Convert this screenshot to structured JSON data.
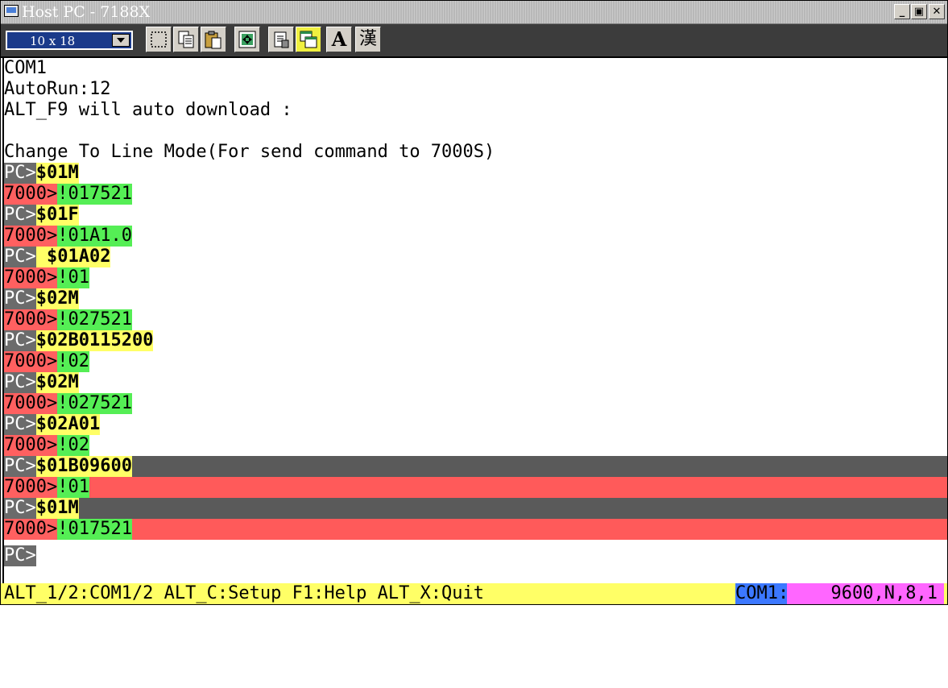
{
  "window": {
    "title": "Host PC - 7188X"
  },
  "toolbar": {
    "font_size_value": "10 x 18",
    "text_button_label": "A",
    "kanji_button_label": "漢"
  },
  "terminal": {
    "lines": [
      "COM1",
      "AutoRun:12",
      "ALT_F9 will auto download :",
      "",
      "Change To Line Mode(For send command to 7000S)"
    ],
    "exchanges": [
      {
        "prompt": "PC>",
        "text": "$01M"
      },
      {
        "prompt": "7000>",
        "text": "!017521"
      },
      {
        "prompt": "PC>",
        "text": "$01F"
      },
      {
        "prompt": "7000>",
        "text": "!01A1.0"
      },
      {
        "prompt": "PC>",
        "text": " $01A02"
      },
      {
        "prompt": "7000>",
        "text": "!01"
      },
      {
        "prompt": "PC>",
        "text": "$02M"
      },
      {
        "prompt": "7000>",
        "text": "!027521"
      },
      {
        "prompt": "PC>",
        "text": "$02B0115200"
      },
      {
        "prompt": "7000>",
        "text": "!02"
      },
      {
        "prompt": "PC>",
        "text": "$02M"
      },
      {
        "prompt": "7000>",
        "text": "!027521"
      },
      {
        "prompt": "PC>",
        "text": "$02A01"
      },
      {
        "prompt": "7000>",
        "text": "!02"
      },
      {
        "prompt": "PC>",
        "text": "$01B09600"
      },
      {
        "prompt": "7000>",
        "text": "!01"
      },
      {
        "prompt": "PC>",
        "text": "$01M"
      },
      {
        "prompt": "7000>",
        "text": "!017521"
      },
      {
        "prompt": "PC>",
        "text": ""
      }
    ]
  },
  "statusbar": {
    "help_text": "ALT_1/2:COM1/2 ALT_C:Setup F1:Help ALT_X:Quit",
    "port": "COM1:",
    "settings": "9600,N,8,1"
  }
}
